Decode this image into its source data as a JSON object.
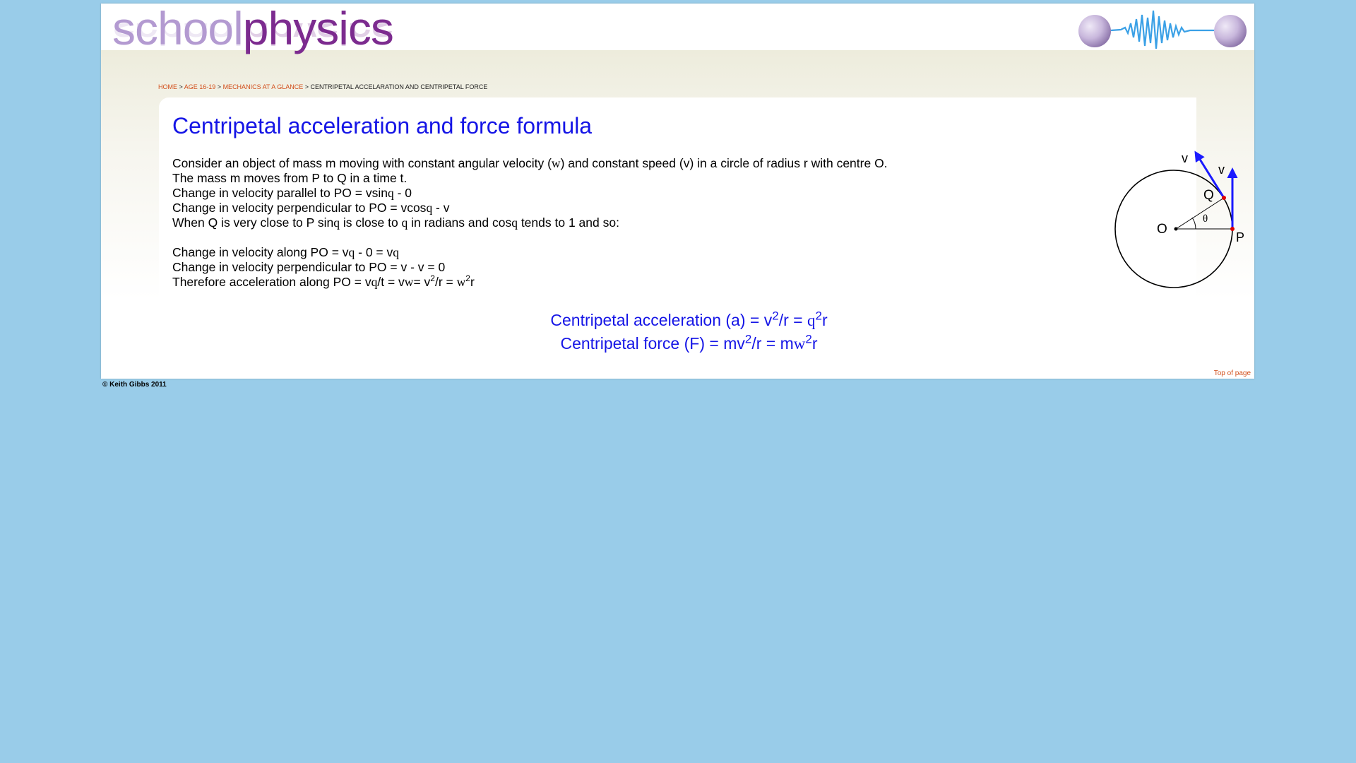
{
  "site": {
    "logo_part1": "school",
    "logo_part2": "physics"
  },
  "breadcrumb": {
    "home": "HOME",
    "sep1": " > ",
    "age": "AGE 16-19",
    "sep2": " > ",
    "mechanics": "MECHANICS AT A GLANCE",
    "sep3": " > ",
    "current": "CENTRIPETAL ACCELARATION AND CENTRIPETAL FORCE"
  },
  "page": {
    "title": "Centripetal acceleration and force formula"
  },
  "content": {
    "l1a": "Consider an object of mass m moving with constant angular velocity (",
    "l1b": "w",
    "l1c": ") and constant speed (v) in a circle of radius r with centre O.",
    "l2": "The mass m moves from P to Q in a time t.",
    "l3a": "Change in velocity parallel to PO = vsin",
    "l3b": "q",
    "l3c": " - 0",
    "l4a": "Change in velocity perpendicular to PO = vcos",
    "l4b": "q",
    "l4c": " - v",
    "l5a": "When Q is very close to P sin",
    "l5b": "q",
    "l5c": " is close to ",
    "l5d": "q",
    "l5e": " in radians and cos",
    "l5f": "q",
    "l5g": " tends to 1 and so:",
    "l6a": "Change in velocity along PO = v",
    "l6b": "q",
    "l6c": " - 0 = v",
    "l6d": "q",
    "l7": "Change in velocity perpendicular to PO = v - v = 0",
    "l8a": "Therefore acceleration along PO = v",
    "l8b": "q",
    "l8c": "/t = v",
    "l8d": "w",
    "l8e": "= v",
    "l8f": "2",
    "l8g": "/r = ",
    "l8h": "w",
    "l8i": "2",
    "l8j": "r"
  },
  "formulas": {
    "f1a": "Centripetal acceleration (a) = v",
    "f1b": "2",
    "f1c": "/r = ",
    "f1d": "q",
    "f1e": "2",
    "f1f": "r",
    "f2a": "Centripetal force (F) = mv",
    "f2b": "2",
    "f2c": "/r = m",
    "f2d": "w",
    "f2e": "2",
    "f2f": "r"
  },
  "diagram": {
    "label_v1": "v",
    "label_v2": "v",
    "label_q": "Q",
    "label_o": "O",
    "label_p": "P",
    "label_theta": "θ",
    "arrow_color": "#1a1aff",
    "point_color": "#dd0000"
  },
  "footer": {
    "top_link": "Top of page",
    "copyright": "© Keith Gibbs 2011"
  },
  "colors": {
    "background": "#99cce9",
    "title": "#1515e6",
    "link": "#d24e1a",
    "logo_light": "#b39ad1",
    "logo_dark": "#7c2b8f"
  }
}
